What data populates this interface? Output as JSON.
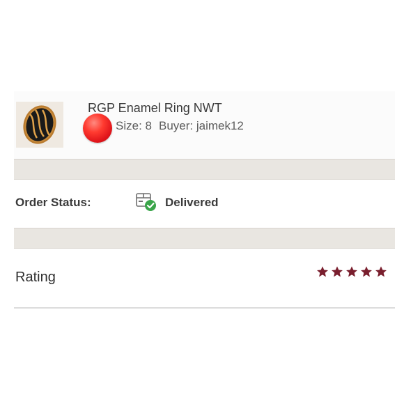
{
  "item": {
    "title": "RGP Enamel Ring NWT",
    "size": "Size: 8",
    "buyer": "Buyer: jaimek12",
    "thumbnail_icon": "ring-photo"
  },
  "order": {
    "status_label": "Order Status:",
    "status_value": "Delivered",
    "status_icon": "package-delivered-icon"
  },
  "rating": {
    "label": "Rating",
    "stars": 5,
    "max_stars": 5,
    "star_color": "#7a1f2e"
  },
  "colors": {
    "separator": "#e9e6e1",
    "delivered_check": "#3aa54a",
    "notification_dot": "#ff3b30"
  }
}
